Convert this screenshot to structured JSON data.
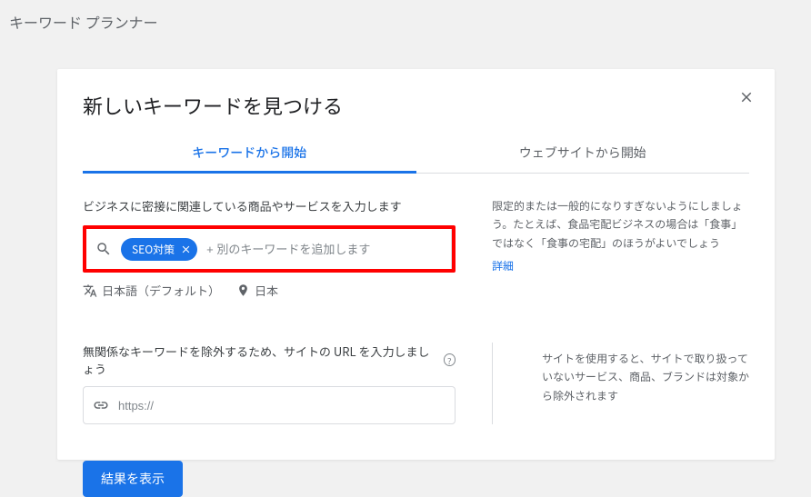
{
  "app_title": "キーワード プランナー",
  "dialog": {
    "title": "新しいキーワードを見つける",
    "tabs": {
      "keyword": "キーワードから開始",
      "website": "ウェブサイトから開始"
    },
    "keyword_section": {
      "label": "ビジネスに密接に関連している商品やサービスを入力します",
      "chip": "SEO対策",
      "placeholder": "+ 別のキーワードを追加します",
      "language": "日本語（デフォルト）",
      "location": "日本",
      "help_text": "限定的または一般的になりすぎないようにしましょう。たとえば、食品宅配ビジネスの場合は「食事」ではなく「食事の宅配」のほうがよいでしょう",
      "help_link": "詳細"
    },
    "url_section": {
      "label": "無関係なキーワードを除外するため、サイトの URL を入力しましょう",
      "placeholder": "https://",
      "help_text": "サイトを使用すると、サイトで取り扱っていないサービス、商品、ブランドは対象から除外されます"
    },
    "submit": "結果を表示"
  },
  "icons": {
    "help_q": "?"
  }
}
